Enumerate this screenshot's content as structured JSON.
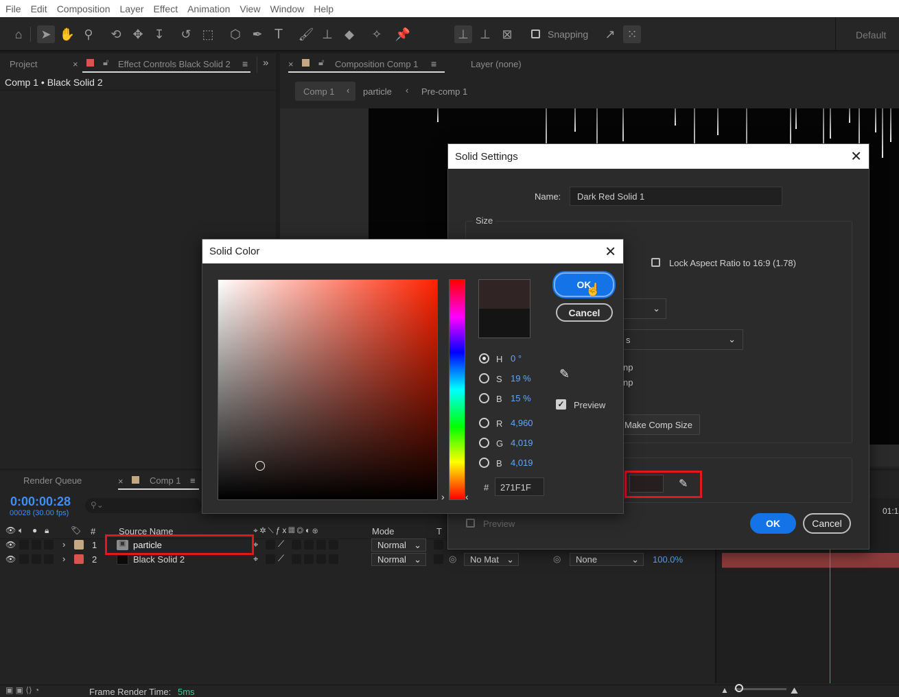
{
  "menu": [
    "File",
    "Edit",
    "Composition",
    "Layer",
    "Effect",
    "Animation",
    "View",
    "Window",
    "Help"
  ],
  "toolbar": {
    "snapping_label": "Snapping",
    "workspace_label": "Default"
  },
  "project_panel": {
    "tab_project": "Project",
    "tab_effect_controls": "Effect Controls Black Solid 2",
    "breadcrumb": "Comp 1 • Black Solid 2"
  },
  "composition_panel": {
    "tab_label": "Composition Comp 1",
    "layer_tab": "Layer (none)",
    "crumbs": [
      "Comp 1",
      "particle",
      "Pre-comp 1"
    ]
  },
  "solid_settings": {
    "title": "Solid Settings",
    "name_label": "Name:",
    "name_value": "Dark Red Solid 1",
    "size_label": "Size",
    "lock_aspect_label": "Lock Aspect Ratio to 16:9 (1.78)",
    "partial_dropdown_text": "s",
    "partial_text_1": "np",
    "partial_text_2": "np",
    "make_comp_size": "Make Comp Size",
    "preview_label": "Preview",
    "ok_label": "OK",
    "cancel_label": "Cancel"
  },
  "solid_color": {
    "title": "Solid Color",
    "ok_label": "OK",
    "cancel_label": "Cancel",
    "preview_label": "Preview",
    "preview_checked": true,
    "h_label": "H",
    "h_value": "0 °",
    "s_label": "S",
    "s_value": "19 %",
    "b_label": "B",
    "b_value": "15 %",
    "r_label": "R",
    "r_value": "4,960",
    "g_label": "G",
    "g_value": "4,019",
    "b2_label": "B",
    "b2_value": "4,019",
    "hash_label": "#",
    "hex_value": "271F1F",
    "new_color": "#302424",
    "old_color": "#141414",
    "field_hue_color": "#ff2200"
  },
  "timeline": {
    "render_queue_tab": "Render Queue",
    "comp_tab": "Comp 1",
    "timecode": "0:00:00:28",
    "frame_info": "00028 (30.00 fps)",
    "search_placeholder": "",
    "col_num": "#",
    "col_source": "Source Name",
    "col_mode": "Mode",
    "col_t": "T",
    "ruler_label": "01:1",
    "layers": [
      {
        "num": "1",
        "name": "particle",
        "mode": "Normal",
        "label_color": "#c4a882"
      },
      {
        "num": "2",
        "name": "Black Solid 2",
        "mode": "Normal",
        "label_color": "#d9544f",
        "trkmat": "No Mat",
        "parent": "None",
        "stretch": "100.0%"
      }
    ]
  },
  "status_bar": {
    "frame_render_label": "Frame Render Time:",
    "frame_render_value": "5ms"
  }
}
